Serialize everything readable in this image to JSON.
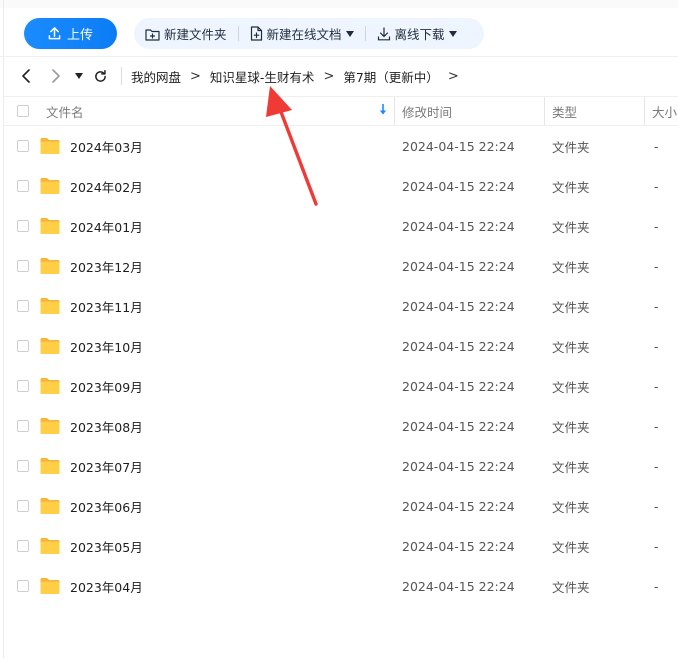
{
  "toolbar": {
    "upload_label": "上传",
    "new_folder_label": "新建文件夹",
    "new_doc_label": "新建在线文档",
    "offline_download_label": "离线下载"
  },
  "breadcrumb": {
    "items": [
      "我的网盘",
      "知识星球-生财有术",
      "第7期（更新中）"
    ]
  },
  "table": {
    "headers": {
      "name": "文件名",
      "modified": "修改时间",
      "type": "类型",
      "size": "大小"
    },
    "rows": [
      {
        "name": "2024年03月",
        "modified": "2024-04-15 22:24",
        "type": "文件夹",
        "size": "-"
      },
      {
        "name": "2024年02月",
        "modified": "2024-04-15 22:24",
        "type": "文件夹",
        "size": "-"
      },
      {
        "name": "2024年01月",
        "modified": "2024-04-15 22:24",
        "type": "文件夹",
        "size": "-"
      },
      {
        "name": "2023年12月",
        "modified": "2024-04-15 22:24",
        "type": "文件夹",
        "size": "-"
      },
      {
        "name": "2023年11月",
        "modified": "2024-04-15 22:24",
        "type": "文件夹",
        "size": "-"
      },
      {
        "name": "2023年10月",
        "modified": "2024-04-15 22:24",
        "type": "文件夹",
        "size": "-"
      },
      {
        "name": "2023年09月",
        "modified": "2024-04-15 22:24",
        "type": "文件夹",
        "size": "-"
      },
      {
        "name": "2023年08月",
        "modified": "2024-04-15 22:24",
        "type": "文件夹",
        "size": "-"
      },
      {
        "name": "2023年07月",
        "modified": "2024-04-15 22:24",
        "type": "文件夹",
        "size": "-"
      },
      {
        "name": "2023年06月",
        "modified": "2024-04-15 22:24",
        "type": "文件夹",
        "size": "-"
      },
      {
        "name": "2023年05月",
        "modified": "2024-04-15 22:24",
        "type": "文件夹",
        "size": "-"
      },
      {
        "name": "2023年04月",
        "modified": "2024-04-15 22:24",
        "type": "文件夹",
        "size": "-"
      }
    ]
  },
  "icons": {
    "upload": "upload-icon",
    "new_folder": "folder-plus-icon",
    "new_doc": "doc-plus-icon",
    "offline_download": "download-icon",
    "back": "chevron-left-icon",
    "forward": "chevron-right-icon",
    "history": "caret-down-icon",
    "refresh": "refresh-icon",
    "folder": "folder-icon",
    "sort": "sort-down-arrow-icon"
  },
  "colors": {
    "accent": "#0d83f7",
    "toolbar_bg": "#eef5fe",
    "folder": "#ffc93c",
    "annotation_arrow": "#ef3a36"
  }
}
